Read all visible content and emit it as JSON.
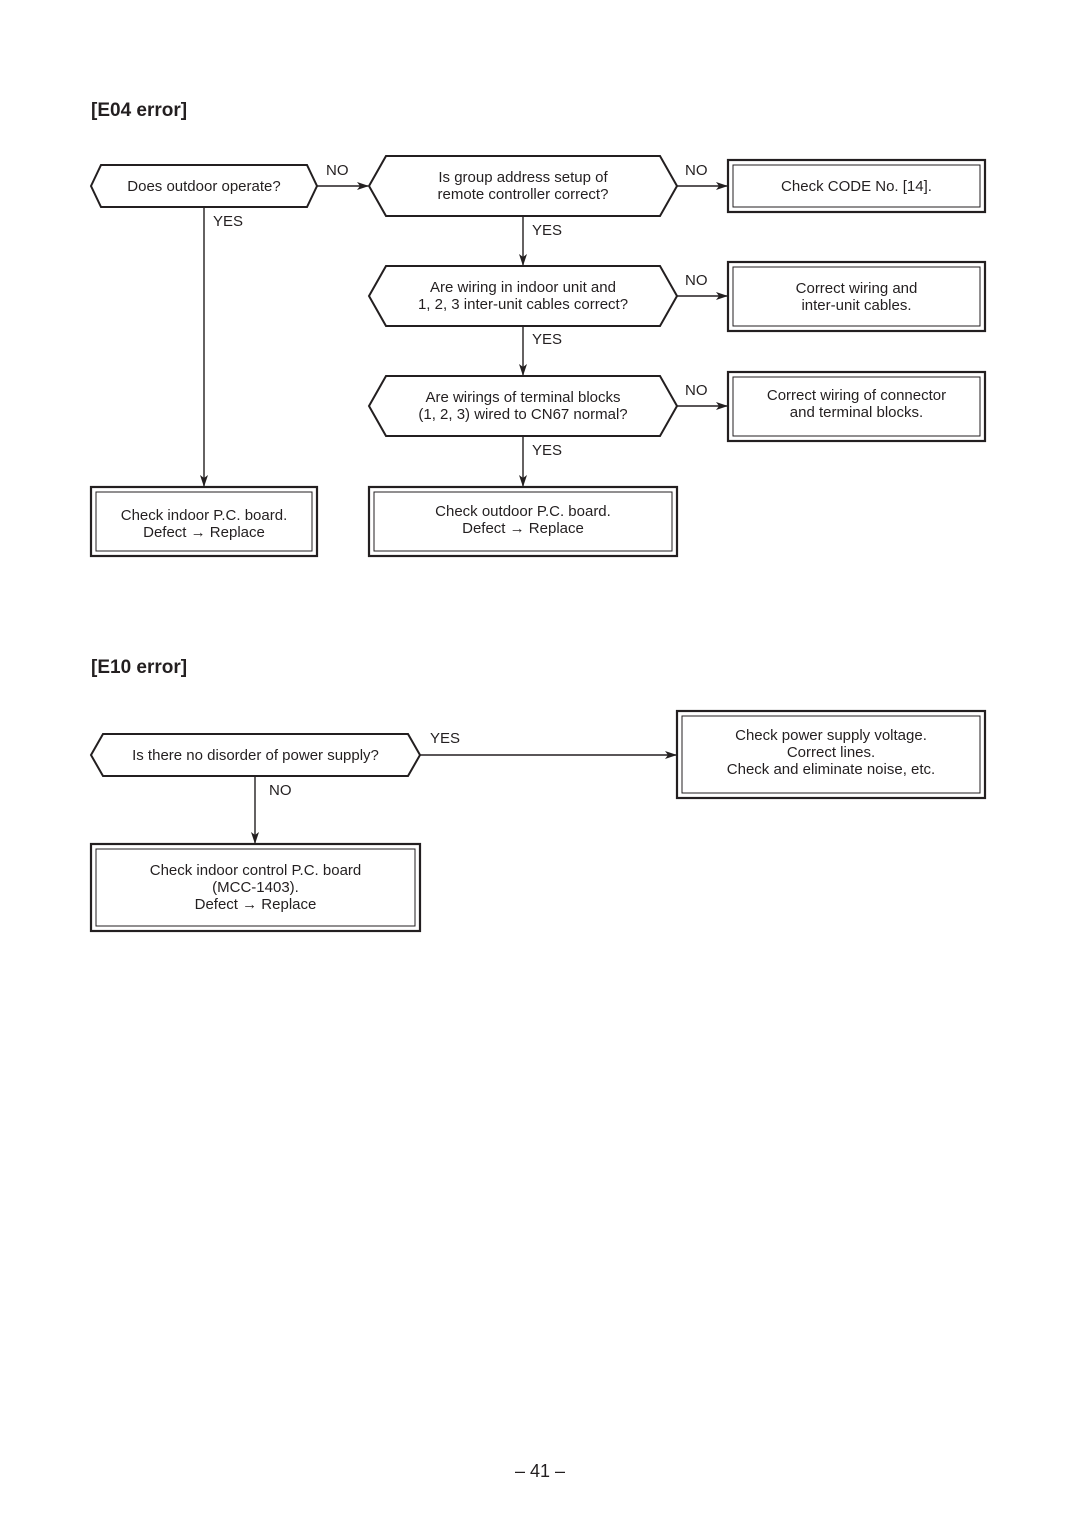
{
  "sections": {
    "e04": {
      "title": "[E04 error]",
      "decisions": {
        "outdoor_operate": [
          "Does outdoor operate?"
        ],
        "group_address": [
          "Is group address setup of",
          "remote controller correct?"
        ],
        "wiring_indoor": [
          "Are wiring in indoor unit and",
          "1, 2, 3 inter-unit cables correct?"
        ],
        "terminal_blocks": [
          "Are wirings of terminal blocks",
          "(1, 2, 3) wired to CN67 normal?"
        ]
      },
      "actions": {
        "check_code": [
          "Check CODE No. [14]."
        ],
        "correct_wiring": [
          "Correct wiring and",
          "inter-unit cables."
        ],
        "correct_connector": [
          "Correct wiring of connector",
          "and terminal blocks."
        ],
        "check_indoor_pcb": [
          "Check indoor P.C. board.",
          "Defect → Replace"
        ],
        "check_outdoor_pcb": [
          "Check outdoor P.C. board.",
          "Defect → Replace"
        ]
      },
      "branch_labels": {
        "outdoor_no": "NO",
        "outdoor_yes": "YES",
        "group_no": "NO",
        "group_yes": "YES",
        "wiring_no": "NO",
        "wiring_yes": "YES",
        "terminal_no": "NO",
        "terminal_yes": "YES"
      }
    },
    "e10": {
      "title": "[E10 error]",
      "decisions": {
        "power_supply": [
          "Is there no disorder of power supply?"
        ]
      },
      "actions": {
        "check_power": [
          "Check power supply voltage.",
          "Correct lines.",
          "Check and eliminate noise, etc."
        ],
        "check_indoor_control_pcb": [
          "Check indoor control P.C. board",
          "(MCC-1403).",
          "Defect → Replace"
        ]
      },
      "branch_labels": {
        "power_yes": "YES",
        "power_no": "NO"
      }
    }
  },
  "footer": {
    "page_number": "– 41 –"
  }
}
